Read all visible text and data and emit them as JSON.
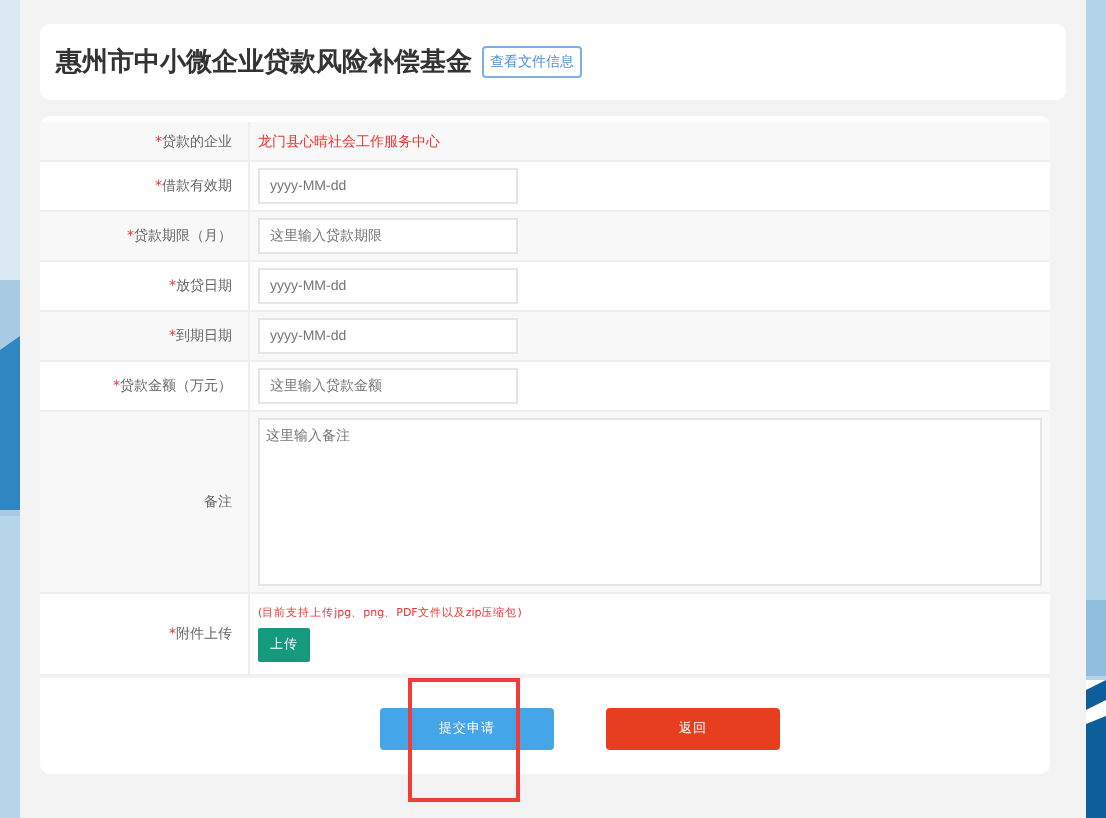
{
  "header": {
    "title": "惠州市中小微企业贷款风险补偿基金",
    "link": "查看文件信息"
  },
  "form": [
    {
      "kind": "text",
      "label": "贷款的企业",
      "mark": "*",
      "value": "龙门县心晴社会工作服务中心"
    },
    {
      "kind": "input",
      "label": "借款有效期",
      "mark": "*",
      "placeholder": "yyyy-MM-dd"
    },
    {
      "kind": "input",
      "label": "贷款期限（月）",
      "mark": "*",
      "placeholder": "这里输入贷款期限"
    },
    {
      "kind": "input",
      "label": "放贷日期",
      "mark": "*",
      "placeholder": "yyyy-MM-dd"
    },
    {
      "kind": "input",
      "label": "到期日期",
      "mark": "*",
      "placeholder": "yyyy-MM-dd"
    },
    {
      "kind": "input",
      "label": "贷款金额（万元）",
      "mark": "*",
      "placeholder": "这里输入贷款金额"
    },
    {
      "kind": "textarea",
      "label": "备注",
      "placeholder": "这里输入备注"
    },
    {
      "kind": "upload",
      "label": "附件上传",
      "mark": "*",
      "hint": "(目前支持上传jpg、png、PDF文件以及zip压缩包)",
      "button": "上传"
    }
  ],
  "buttons": [
    {
      "kind": "primary",
      "label": "提交申请",
      "highlighted": true
    },
    {
      "kind": "danger",
      "label": "返回",
      "highlighted": false
    }
  ]
}
